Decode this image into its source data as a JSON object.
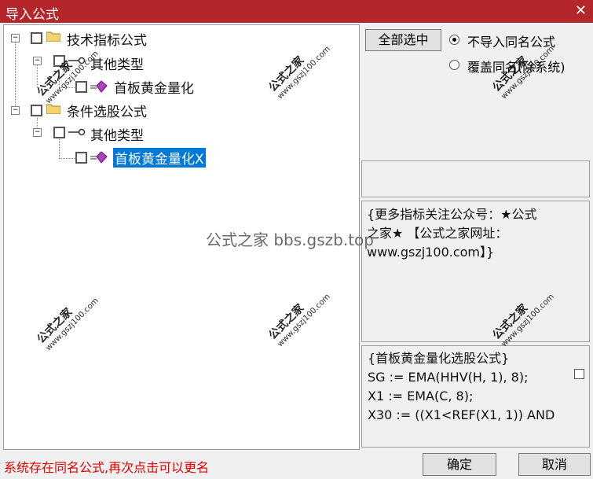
{
  "window": {
    "title": "导入公式",
    "close_glyph": "✕"
  },
  "tree": {
    "n1": "技术指标公式",
    "n1_child": "其他类型",
    "n1_leaf": "首板黄金量化",
    "n2": "条件选股公式",
    "n2_child": "其他类型",
    "n2_leaf": "首板黄金量化X",
    "expand_glyph": "−"
  },
  "right": {
    "select_all": "全部选中",
    "radio1": "不导入同名公式",
    "radio2": "覆盖同名(除系统)",
    "selected_radio": "radio1",
    "desc_lines": [
      "{更多指标关注公众号：★公式",
      "之家★ 【公式之家网址：",
      "www.gszj100.com】}"
    ],
    "code_lines": [
      "{首板黄金量化选股公式}",
      "SG := EMA(HHV(H, 1), 8);",
      "X1 := EMA(C, 8);",
      "X30 := ((X1<REF(X1, 1)) AND"
    ]
  },
  "status_text": "系统存在同名公式,再次点击可以更名",
  "buttons": {
    "ok": "确定",
    "cancel": "取消"
  },
  "watermark": {
    "main": "公式之家",
    "sub": "www.gszj100.com",
    "center": "公式之家 bbs.gszb.top"
  },
  "colors": {
    "titlebar": "#b5262b",
    "selection": "#0078d7",
    "status": "#e00000"
  }
}
